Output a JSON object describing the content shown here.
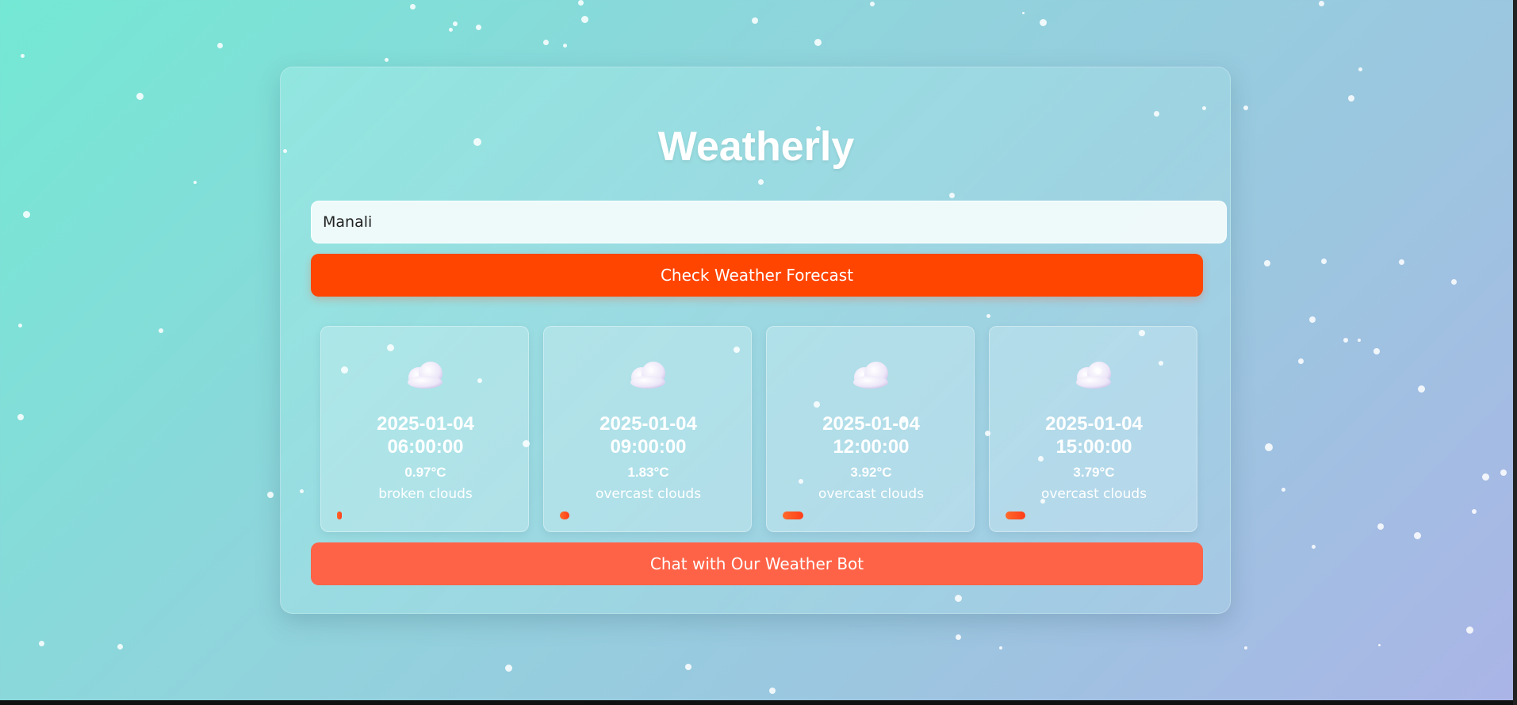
{
  "app": {
    "title": "Weatherly"
  },
  "search": {
    "value": "Manali",
    "button_label": "Check Weather Forecast"
  },
  "forecast": [
    {
      "date": "2025-01-04",
      "time": "06:00:00",
      "temp": "0.97°C",
      "description": "broken clouds",
      "icon": "cloud-icon",
      "temp_value": 0.97
    },
    {
      "date": "2025-01-04",
      "time": "09:00:00",
      "temp": "1.83°C",
      "description": "overcast clouds",
      "icon": "cloud-icon",
      "temp_value": 1.83
    },
    {
      "date": "2025-01-04",
      "time": "12:00:00",
      "temp": "3.92°C",
      "description": "overcast clouds",
      "icon": "cloud-icon",
      "temp_value": 3.92
    },
    {
      "date": "2025-01-04",
      "time": "15:00:00",
      "temp": "3.79°C",
      "description": "overcast clouds",
      "icon": "cloud-icon",
      "temp_value": 3.79
    }
  ],
  "chat": {
    "button_label": "Chat with Our Weather Bot"
  },
  "colors": {
    "primary_button": "#ff4500",
    "chat_button": "#ff6347",
    "text": "#ffffff"
  }
}
